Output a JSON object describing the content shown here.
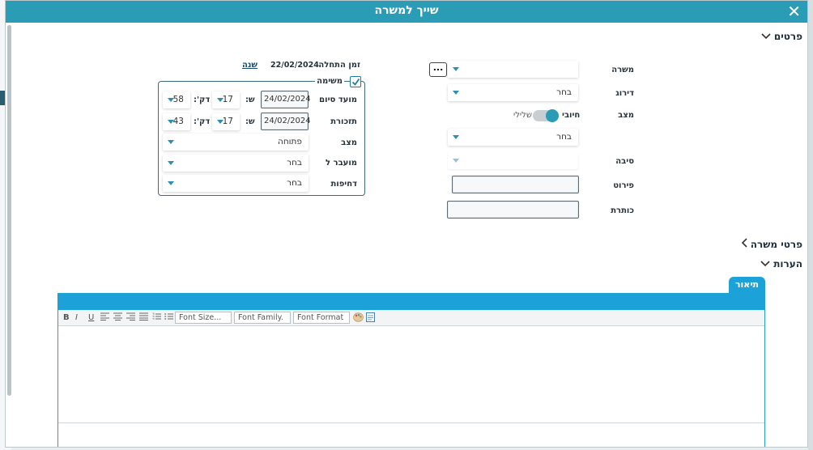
{
  "dialog": {
    "title": "שייך למשרה",
    "close_glyph": "✕"
  },
  "sections": {
    "details": "פרטים",
    "job_details": "פרטי משרה",
    "notes": "הערות"
  },
  "right_form": {
    "job_label": "משרה",
    "job_value": "",
    "dots_label": "...",
    "rating_label": "דירוג",
    "rating_value": "בחר",
    "status_label": "מצב",
    "toggle_on_label": "חיובי",
    "toggle_off_label": "שלילי",
    "status_select_value": "בחר",
    "reason_label": "סיבה",
    "reason_value": "",
    "detail_label": "פירוט",
    "detail_value": "",
    "heading_label": "כותרת",
    "heading_value": ""
  },
  "left_form": {
    "start_label": "זמן התחלה",
    "start_value": "22/02/2024",
    "year_link": "שנה",
    "task_label": "משימה",
    "due_label": "מועד סיום",
    "due_date": "24/02/2024",
    "due_hour_label": "ש:",
    "due_hour": "17",
    "due_min_label": "דק':",
    "due_min": "58",
    "reminder_label": "תזכורת",
    "reminder_date": "24/02/2024",
    "reminder_hour_label": "ש:",
    "reminder_hour": "17",
    "reminder_min_label": "דק':",
    "reminder_min": "43",
    "state_label": "מצב",
    "state_value": "פתוחה",
    "transfer_label": "מועבר ל",
    "transfer_value": "בחר",
    "priority_label": "דחיפות",
    "priority_value": "בחר"
  },
  "editor": {
    "tab_label": "תיאור",
    "tools": {
      "bold": "B",
      "italic": "I",
      "underline": "U"
    },
    "font_size": "Font Size...",
    "font_family": "Font Family.",
    "font_format": "Font Format"
  },
  "colors": {
    "title_bar": "#2a9cb6",
    "accent": "#1ca2d8",
    "toggle_knob": "#2a9cb6"
  }
}
